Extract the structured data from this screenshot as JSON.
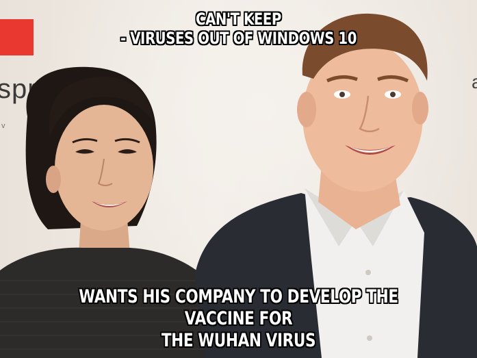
{
  "meme": {
    "top_text": {
      "line1": "CAN'T KEEP",
      "line2": "- VIRUSES OUT OF WINDOWS 10"
    },
    "bottom_text": {
      "line1": "WANTS HIS COMPANY TO DEVELOP THE VACCINE FOR",
      "line2": "THE WUHAN VIRUS"
    },
    "backdrop": {
      "word_left": "spr",
      "word_right": "a",
      "small_text": "v"
    }
  }
}
